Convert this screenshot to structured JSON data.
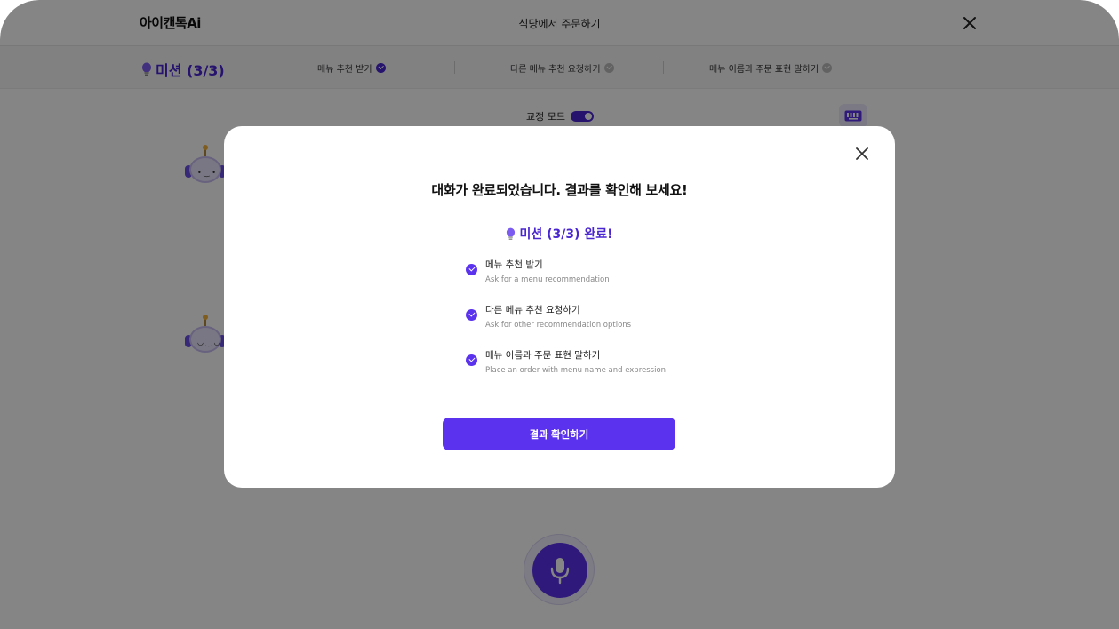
{
  "app": {
    "logo_text": "아이캔톡Ai",
    "page_title": "식당에서 주문하기"
  },
  "mission_bar": {
    "label": "미션 (3/3)",
    "steps": [
      {
        "label": "메뉴 추천 받기",
        "status": "done"
      },
      {
        "label": "다른 메뉴 추천 요청하기",
        "status": "todo"
      },
      {
        "label": "메뉴 이름과 주문 표현 말하기",
        "status": "todo"
      }
    ]
  },
  "controls": {
    "correction_mode_label": "교정 모드",
    "correction_mode_on": true
  },
  "modal": {
    "title": "대화가 완료되었습니다. 결과를 확인해 보세요!",
    "mission_complete": "미션 (3/3) 완료!",
    "items": [
      {
        "title": "메뉴 추천 받기",
        "subtitle": "Ask for a menu recommendation"
      },
      {
        "title": "다른 메뉴 추천 요청하기",
        "subtitle": "Ask for other recommendation options"
      },
      {
        "title": "메뉴 이름과 주문 표현 말하기",
        "subtitle": "Place an order with menu name and expression"
      }
    ],
    "button_label": "결과 확인하기"
  },
  "colors": {
    "accent": "#5b32ee",
    "mission_text": "#4a26d1",
    "overlay": "rgba(0,0,0,0.48)"
  },
  "icons": [
    "close-icon",
    "lightbulb-icon",
    "check-circle-icon",
    "keyboard-icon",
    "microphone-icon",
    "robot-avatar"
  ]
}
